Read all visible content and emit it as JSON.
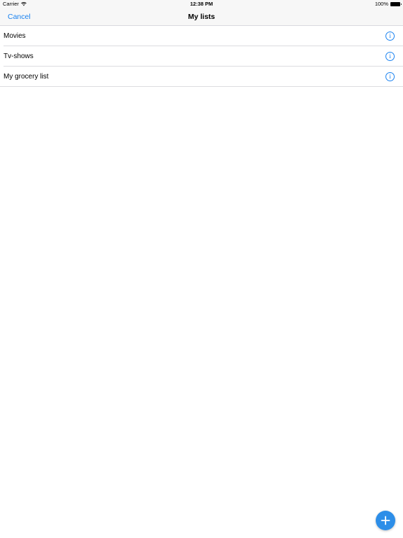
{
  "status_bar": {
    "carrier": "Carrier",
    "time": "12:38 PM",
    "battery": "100%"
  },
  "nav_bar": {
    "cancel_label": "Cancel",
    "title": "My lists"
  },
  "lists": [
    {
      "label": "Movies"
    },
    {
      "label": "Tv-shows"
    },
    {
      "label": "My grocery list"
    }
  ],
  "colors": {
    "accent": "#1a82f0",
    "fab": "#2d8ee8"
  },
  "icons": {
    "wifi": "wifi-icon",
    "battery": "battery-icon",
    "info": "info-icon",
    "add": "plus-icon"
  }
}
